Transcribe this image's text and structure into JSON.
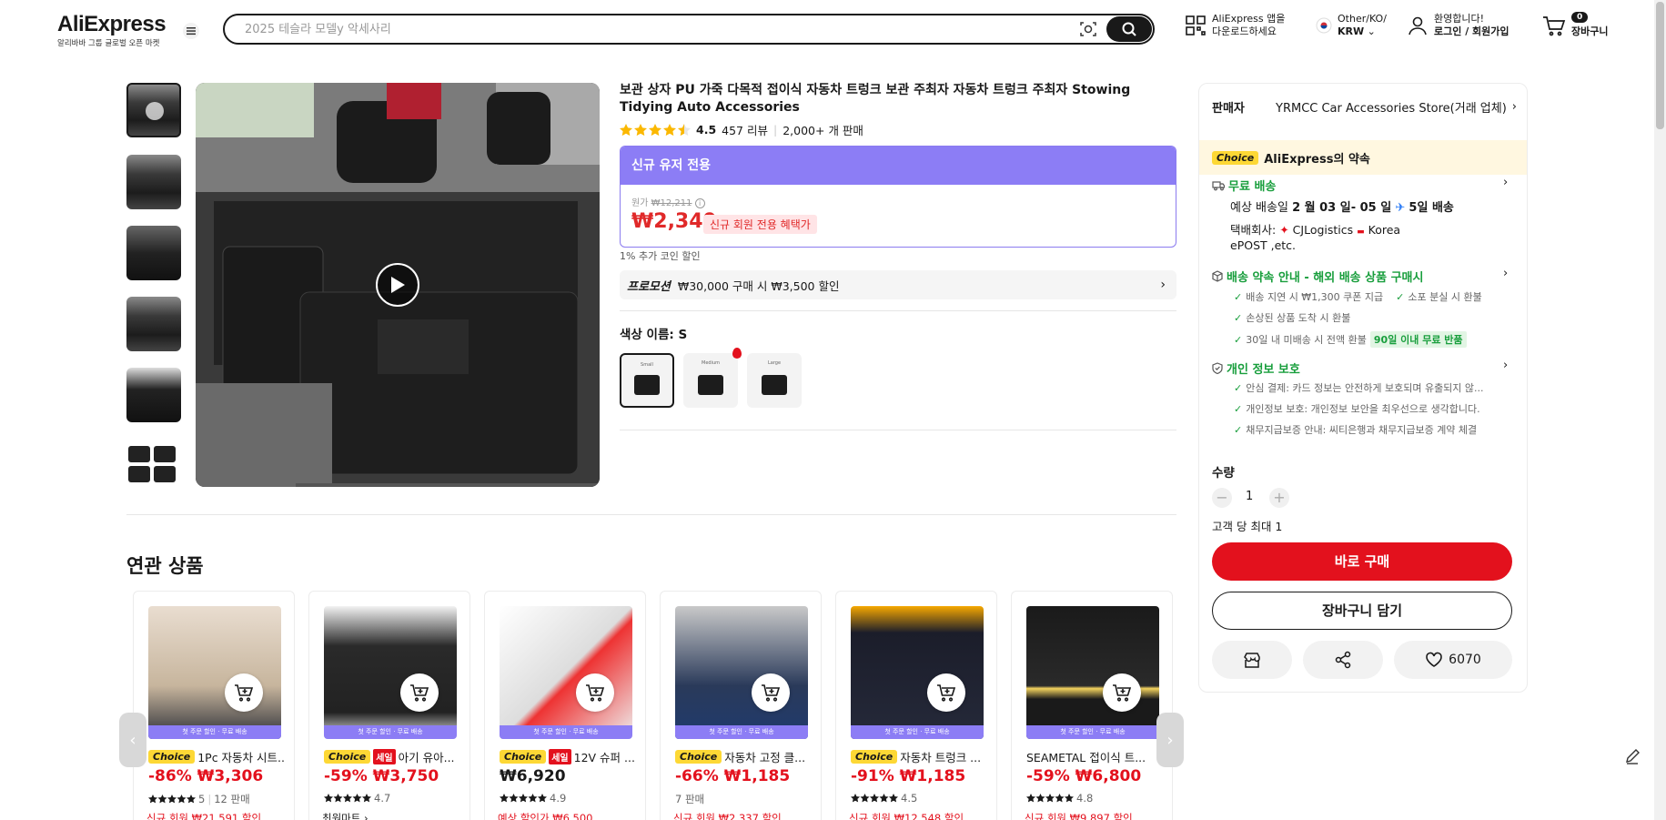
{
  "header": {
    "brand": "AliExpress",
    "tagline": "알리바바 그룹 글로벌 오픈 마켓",
    "search_placeholder": "2025 테슬라 모델y 악세사리",
    "app_download": "AliExpress 앱을 다운로드하세요",
    "region_top": "Other/KO/",
    "region_currency": "KRW",
    "welcome": "환영합니다!",
    "login": "로그인 / 회원가입",
    "cart_count": "0",
    "cart_label": "장바구니"
  },
  "product": {
    "title": "보관 상자 PU 가죽 다목적 접이식 자동차 트렁크 보관 주최자 자동차 트렁크 주최자 Stowing Tidying Auto Accessories",
    "rating": "4.5",
    "reviews": "457 리뷰",
    "sold": "2,000+ 개 판매",
    "new_user_header": "신규 유저 전용",
    "orig_label": "원가",
    "orig_price": "₩12,211",
    "price": "₩2,349",
    "benefit": "신규 회원 전용 혜택가",
    "coin": "1% 추가 코인 할인",
    "promo_label": "프로모션",
    "promo_text": "₩30,000 구매 시 ₩3,500 할인",
    "color_label": "색상 이름: S",
    "skus": [
      "Small",
      "Medium",
      "Large"
    ]
  },
  "panel": {
    "seller_label": "판매자",
    "seller_name": "YRMCC Car Accessories Store(거래 업체)",
    "choice_badge": "Choice",
    "promise": "AliExpress의 약속",
    "free_shipping": "무료 배송",
    "delivery_prefix": "예상 배송일",
    "delivery_date": "2 월 03 일- 05 일",
    "delivery_fast": "5일 배송",
    "carrier_label": "택배회사:",
    "carrier1": "CJLogistics",
    "carrier2": "Korea",
    "carrier3": "ePOST ,etc.",
    "guarantee_title": "배송 약속 안내 - 해외 배송 상품 구매시",
    "g1": "배송 지연 시 ₩1,300 쿠폰 지급",
    "g2": "소포 분실 시 환불",
    "g3": "손상된 상품 도착 시 환불",
    "g4": "30일 내 미배송 시 전액 환불",
    "g4_pill": "90일 이내 무료 반품",
    "privacy_title": "개인 정보 보호",
    "p1": "안심 결제: 카드 정보는 안전하게 보호되며 유출되지 않...",
    "p2": "개인정보 보호: 개인정보 보안을 최우선으로 생각합니다.",
    "p3": "채무지급보증 안내: 씨티은행과 채무지급보증 계약 체결",
    "qty_label": "수량",
    "qty": "1",
    "limit": "고객 당 최대 1",
    "buy_now": "바로 구매",
    "add_cart": "장바구니 담기",
    "wishlist": "6070"
  },
  "related": {
    "title": "연관 상품",
    "banner": "첫 주문 할인 · 무료 배송",
    "items": [
      {
        "choice": "Choice",
        "sale": "",
        "name": "1Pc 자동차 시트...",
        "price": "-86% ₩3,306",
        "rating": "5",
        "meta2": "12 판매",
        "sub": "신규 회원 ₩21,591 할인"
      },
      {
        "choice": "Choice",
        "sale": "세일",
        "name": "아기 유아...",
        "price": "-59% ₩3,750",
        "rating": "4.7",
        "meta2": "",
        "sub": "최원마트 ›"
      },
      {
        "choice": "Choice",
        "sale": "세일",
        "name": "12V 슈퍼 ...",
        "price": "₩6,920",
        "rating": "4.9",
        "meta2": "",
        "sub": "예상 할인가 ₩6,500"
      },
      {
        "choice": "Choice",
        "sale": "",
        "name": "자동차 고정 클...",
        "price": "-66% ₩1,185",
        "rating": "",
        "meta2": "7 판매",
        "sub": "신규 회원 ₩2,337 할인"
      },
      {
        "choice": "Choice",
        "sale": "",
        "name": "자동차 트렁크 ...",
        "price": "-91% ₩1,185",
        "rating": "4.5",
        "meta2": "",
        "sub": "신규 회원 ₩12,548 할인"
      },
      {
        "choice": "",
        "sale": "",
        "name": "SEAMETAL 접이식 트...",
        "price": "-59% ₩6,800",
        "rating": "4.8",
        "meta2": "",
        "sub": "신규 회원 ₩9,897 할인"
      }
    ]
  }
}
